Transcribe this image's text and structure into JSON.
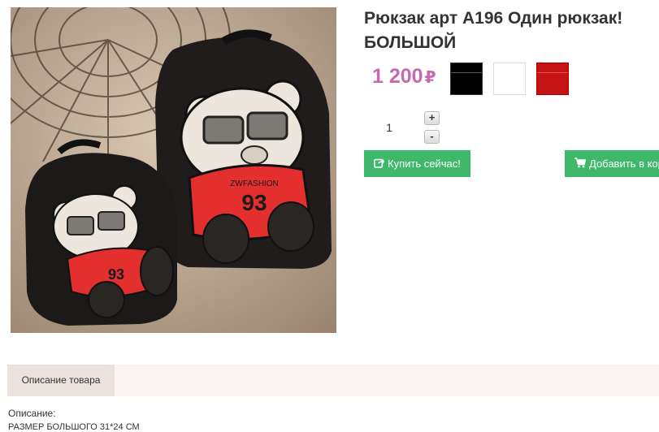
{
  "product": {
    "title": "Рюкзак арт А196 Один рюкзак! БОЛЬШОЙ",
    "price": "1 200",
    "currency": "₽",
    "image_alt": "backpacks with bear print",
    "colors": [
      "#000000",
      "#ffffff",
      "#c61414"
    ]
  },
  "quantity": {
    "value": "1",
    "plus": "+",
    "minus": "-"
  },
  "actions": {
    "buy_now": "Купить сейчас!",
    "add_to_cart": "Добавить в кор"
  },
  "tabs": [
    {
      "label": "Описание товара"
    }
  ],
  "description": {
    "label": "Описание:",
    "size_line": "РАЗМЕР БОЛЬШОГО 31*24 СМ"
  }
}
